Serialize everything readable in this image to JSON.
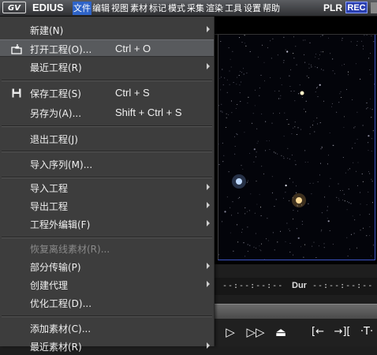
{
  "titlebar": {
    "app_name": "EDIUS",
    "logo": "GV",
    "menus": [
      "文件",
      "编辑",
      "视图",
      "素材",
      "标记",
      "模式",
      "采集",
      "渲染",
      "工具",
      "设置",
      "帮助"
    ],
    "plr": "PLR",
    "rec": "REC"
  },
  "menu": {
    "items": [
      {
        "label": "新建(N)",
        "submenu": true
      },
      {
        "label": "打开工程(O)...",
        "shortcut": "Ctrl + O",
        "icon": "open-folder-icon",
        "highlighted": true
      },
      {
        "label": "最近工程(R)",
        "submenu": true
      },
      {
        "label": "保存工程(S)",
        "shortcut": "Ctrl + S",
        "icon": "floppy-disk-icon"
      },
      {
        "label": "另存为(A)...",
        "shortcut": "Shift + Ctrl + S"
      },
      {
        "label": "退出工程(J)"
      },
      {
        "label": "导入序列(M)..."
      },
      {
        "label": "导入工程",
        "submenu": true
      },
      {
        "label": "导出工程",
        "submenu": true
      },
      {
        "label": "工程外编辑(F)",
        "submenu": true
      },
      {
        "label": "恢复离线素材(R)...",
        "disabled": true
      },
      {
        "label": "部分传输(P)",
        "submenu": true
      },
      {
        "label": "创建代理",
        "submenu": true
      },
      {
        "label": "优化工程(D)..."
      },
      {
        "label": "添加素材(C)..."
      },
      {
        "label": "最近素材(R)",
        "submenu": true
      }
    ]
  },
  "timecode": {
    "in": "--:--:--:--",
    "dur_label": "Dur",
    "dur": "--:--:--:--"
  },
  "transport": {
    "play": "▷",
    "fast_forward": "▷▷",
    "loop": "⏏",
    "mark_in": "[←",
    "mark_out": "→][",
    "split": "·T·"
  }
}
